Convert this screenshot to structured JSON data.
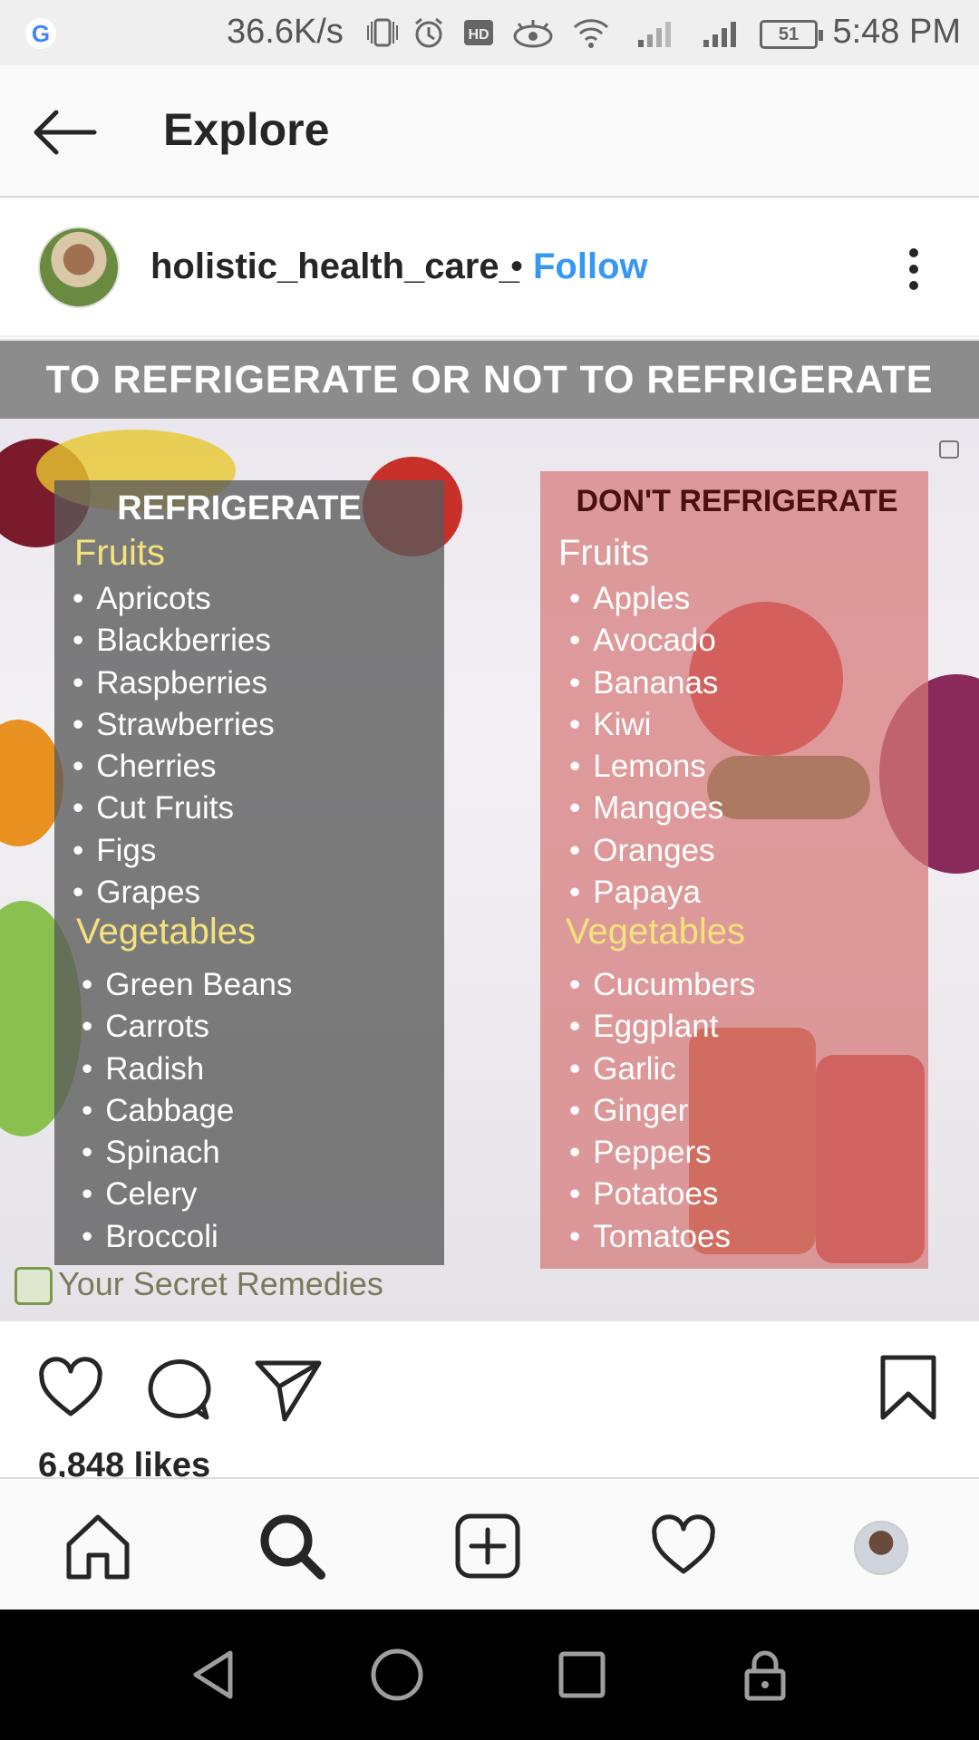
{
  "status_bar": {
    "google_icon": "G",
    "network_speed": "36.6K/s",
    "battery": "51",
    "time": "5:48 PM"
  },
  "header": {
    "title": "Explore"
  },
  "post": {
    "username": "holistic_health_care_",
    "separator": "•",
    "follow_label": "Follow",
    "image": {
      "banner": "TO REFRIGERATE OR NOT TO REFRIGERATE",
      "refrigerate": {
        "title": "REFRIGERATE",
        "fruits_label": "Fruits",
        "fruits": [
          "Apricots",
          "Blackberries",
          "Raspberries",
          "Strawberries",
          "Cherries",
          "Cut Fruits",
          "Figs",
          "Grapes"
        ],
        "vegetables_label": "Vegetables",
        "vegetables": [
          "Green Beans",
          "Carrots",
          "Radish",
          "Cabbage",
          "Spinach",
          "Celery",
          "Broccoli"
        ]
      },
      "dont_refrigerate": {
        "title": "DON'T REFRIGERATE",
        "fruits_label": "Fruits",
        "fruits": [
          "Apples",
          "Avocado",
          "Bananas",
          "Kiwi",
          "Lemons",
          "Mangoes",
          "Oranges",
          "Papaya"
        ],
        "vegetables_label": "Vegetables",
        "vegetables": [
          "Cucumbers",
          "Eggplant",
          "Garlic",
          "Ginger",
          "Peppers",
          "Potatoes",
          "Tomatoes"
        ]
      },
      "watermark": "Your Secret Remedies"
    },
    "likes": "6,848 likes"
  },
  "bottom_nav": [
    "home-icon",
    "search-icon",
    "add-icon",
    "activity-heart-icon",
    "profile-avatar"
  ],
  "colors": {
    "follow": "#3897f0",
    "left_panel": "#5a5a5a",
    "right_panel": "#d67878",
    "section_yellow": "#f5e27a"
  }
}
